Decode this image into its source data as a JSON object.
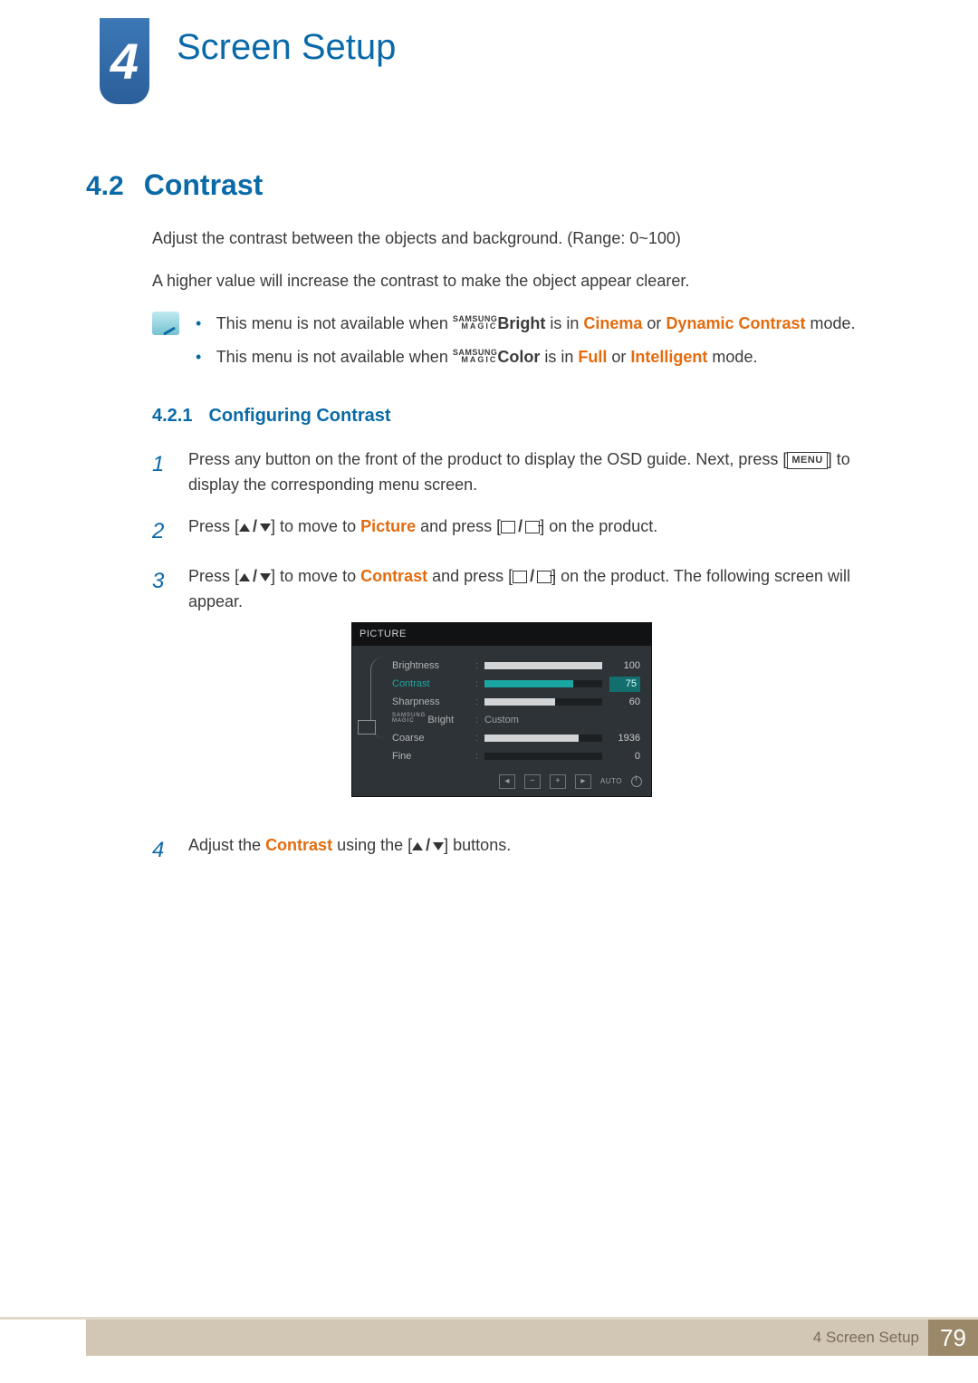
{
  "chapter": {
    "number": "4",
    "title": "Screen Setup"
  },
  "section": {
    "number": "4.2",
    "title": "Contrast",
    "intro1": "Adjust the contrast between the objects and background. (Range: 0~100)",
    "intro2": "A higher value will increase the contrast to make the object appear clearer."
  },
  "notes": {
    "prefix": "This menu is not available when ",
    "magic_top": "SAMSUNG",
    "magic_bot": "MAGIC",
    "n1_word": "Bright",
    "n1_mid": " is in ",
    "n1_a": "Cinema",
    "n1_or": " or ",
    "n1_b": "Dynamic Contrast",
    "n1_tail": " mode.",
    "n2_word": "Color",
    "n2_mid": " is in ",
    "n2_a": "Full",
    "n2_or": " or ",
    "n2_b": "Intelligent",
    "n2_tail": " mode."
  },
  "subsection": {
    "number": "4.2.1",
    "title": "Configuring Contrast"
  },
  "steps": {
    "s1_a": "Press any button on the front of the product to display the OSD guide. Next, press [",
    "s1_menu": "MENU",
    "s1_b": "] to display the corresponding menu screen.",
    "s2_a": "Press [",
    "s2_b": "] to move to ",
    "s2_word": "Picture",
    "s2_c": " and press [",
    "s2_d": "] on the product.",
    "s3_a": "Press [",
    "s3_b": "] to move to ",
    "s3_word": "Contrast",
    "s3_c": " and press [",
    "s3_d": "] on the product. The following screen will appear.",
    "s4_a": "Adjust the ",
    "s4_word": "Contrast",
    "s4_b": " using the [",
    "s4_c": "] buttons."
  },
  "osd": {
    "title": "PICTURE",
    "rows": {
      "brightness": {
        "label": "Brightness",
        "value": "100",
        "pct": 100
      },
      "contrast": {
        "label": "Contrast",
        "value": "75",
        "pct": 75
      },
      "sharpness": {
        "label": "Sharpness",
        "value": "60",
        "pct": 60
      },
      "magic": {
        "top": "SAMSUNG",
        "bot": "MAGIC",
        "word": "Bright",
        "value": "Custom"
      },
      "coarse": {
        "label": "Coarse",
        "value": "1936",
        "pct": 80
      },
      "fine": {
        "label": "Fine",
        "value": "0",
        "pct": 0
      }
    },
    "foot_auto": "AUTO"
  },
  "footer": {
    "text": "4 Screen Setup",
    "page": "79"
  }
}
